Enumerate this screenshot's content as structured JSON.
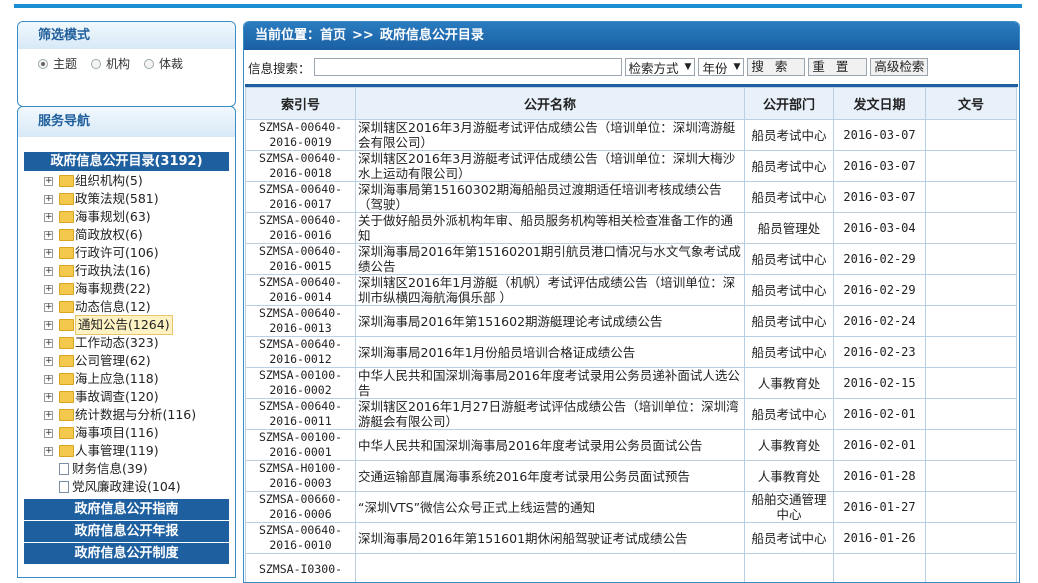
{
  "filter": {
    "title": "筛选模式",
    "options": [
      {
        "label": "主题",
        "checked": true
      },
      {
        "label": "机构",
        "checked": false
      },
      {
        "label": "体裁",
        "checked": false
      }
    ]
  },
  "nav": {
    "title": "服务导航",
    "catalog": "政府信息公开目录(3192)",
    "items": [
      {
        "label": "组织机构(5)",
        "type": "folder"
      },
      {
        "label": "政策法规(581)",
        "type": "folder"
      },
      {
        "label": "海事规划(63)",
        "type": "folder"
      },
      {
        "label": "简政放权(6)",
        "type": "folder"
      },
      {
        "label": "行政许可(106)",
        "type": "folder"
      },
      {
        "label": "行政执法(16)",
        "type": "folder"
      },
      {
        "label": "海事规费(22)",
        "type": "folder"
      },
      {
        "label": "动态信息(12)",
        "type": "folder"
      },
      {
        "label": "通知公告(1264)",
        "type": "folder"
      },
      {
        "label": "工作动态(323)",
        "type": "folder"
      },
      {
        "label": "公司管理(62)",
        "type": "folder"
      },
      {
        "label": "海上应急(118)",
        "type": "folder"
      },
      {
        "label": "事故调查(120)",
        "type": "folder"
      },
      {
        "label": "统计数据与分析(116)",
        "type": "folder"
      },
      {
        "label": "海事项目(116)",
        "type": "folder"
      },
      {
        "label": "人事管理(119)",
        "type": "folder"
      },
      {
        "label": "财务信息(39)",
        "type": "doc"
      },
      {
        "label": "党风廉政建设(104)",
        "type": "doc"
      }
    ],
    "links": [
      "政府信息公开指南",
      "政府信息公开年报",
      "政府信息公开制度"
    ]
  },
  "breadcrumb": {
    "prefix": "当前位置：",
    "home": "首页",
    "sep": ">>",
    "current": "政府信息公开目录"
  },
  "search": {
    "label": "信息搜索：",
    "value": "",
    "method": "检索方式",
    "year": "年份",
    "search_btn": "搜  索",
    "reset_btn": "重  置",
    "advanced_btn": "高级检索"
  },
  "table": {
    "headers": [
      "索引号",
      "公开名称",
      "公开部门",
      "发文日期",
      "文号"
    ],
    "rows": [
      {
        "idx": "SZMSA-00640-2016-0019",
        "title": "深圳辖区2016年3月游艇考试评估成绩公告（培训单位：深圳湾游艇会有限公司）",
        "dept": "船员考试中心",
        "date": "2016-03-07",
        "doc": ""
      },
      {
        "idx": "SZMSA-00640-2016-0018",
        "title": "深圳辖区2016年3月游艇考试评估成绩公告（培训单位：深圳大梅沙水上运动有限公司）",
        "dept": "船员考试中心",
        "date": "2016-03-07",
        "doc": ""
      },
      {
        "idx": "SZMSA-00640-2016-0017",
        "title": "深圳海事局第15160302期海船船员过渡期适任培训考核成绩公告（驾驶）",
        "dept": "船员考试中心",
        "date": "2016-03-07",
        "doc": ""
      },
      {
        "idx": "SZMSA-00640-2016-0016",
        "title": "关于做好船员外派机构年审、船员服务机构等相关检查准备工作的通知",
        "dept": "船员管理处",
        "date": "2016-03-04",
        "doc": ""
      },
      {
        "idx": "SZMSA-00640-2016-0015",
        "title": "深圳海事局2016年第15160201期引航员港口情况与水文气象考试成绩公告",
        "dept": "船员考试中心",
        "date": "2016-02-29",
        "doc": ""
      },
      {
        "idx": "SZMSA-00640-2016-0014",
        "title": "深圳辖区2016年1月游艇（机帆）考试评估成绩公告（培训单位：深圳市纵横四海航海俱乐部 ）",
        "dept": "船员考试中心",
        "date": "2016-02-29",
        "doc": ""
      },
      {
        "idx": "SZMSA-00640-2016-0013",
        "title": "深圳海事局2016年第151602期游艇理论考试成绩公告",
        "dept": "船员考试中心",
        "date": "2016-02-24",
        "doc": ""
      },
      {
        "idx": "SZMSA-00640-2016-0012",
        "title": "深圳海事局2016年1月份船员培训合格证成绩公告",
        "dept": "船员考试中心",
        "date": "2016-02-23",
        "doc": ""
      },
      {
        "idx": "SZMSA-00100-2016-0002",
        "title": "中华人民共和国深圳海事局2016年度考试录用公务员递补面试人选公告",
        "dept": "人事教育处",
        "date": "2016-02-15",
        "doc": ""
      },
      {
        "idx": "SZMSA-00640-2016-0011",
        "title": "深圳辖区2016年1月27日游艇考试评估成绩公告（培训单位：深圳湾游艇会有限公司）",
        "dept": "船员考试中心",
        "date": "2016-02-01",
        "doc": ""
      },
      {
        "idx": "SZMSA-00100-2016-0001",
        "title": "中华人民共和国深圳海事局2016年度考试录用公务员面试公告",
        "dept": "人事教育处",
        "date": "2016-02-01",
        "doc": ""
      },
      {
        "idx": "SZMSA-H0100-2016-0003",
        "title": "交通运输部直属海事系统2016年度考试录用公务员面试预告",
        "dept": "人事教育处",
        "date": "2016-01-28",
        "doc": ""
      },
      {
        "idx": "SZMSA-00660-2016-0006",
        "title": "“深圳VTS”微信公众号正式上线运营的通知",
        "dept": "船舶交通管理中心",
        "date": "2016-01-27",
        "doc": ""
      },
      {
        "idx": "SZMSA-00640-2016-0010",
        "title": "深圳海事局2016年第151601期休闲船驾驶证考试成绩公告",
        "dept": "船员考试中心",
        "date": "2016-01-26",
        "doc": ""
      },
      {
        "idx": "SZMSA-I0300-",
        "title": "",
        "dept": "",
        "date": "",
        "doc": ""
      }
    ]
  }
}
